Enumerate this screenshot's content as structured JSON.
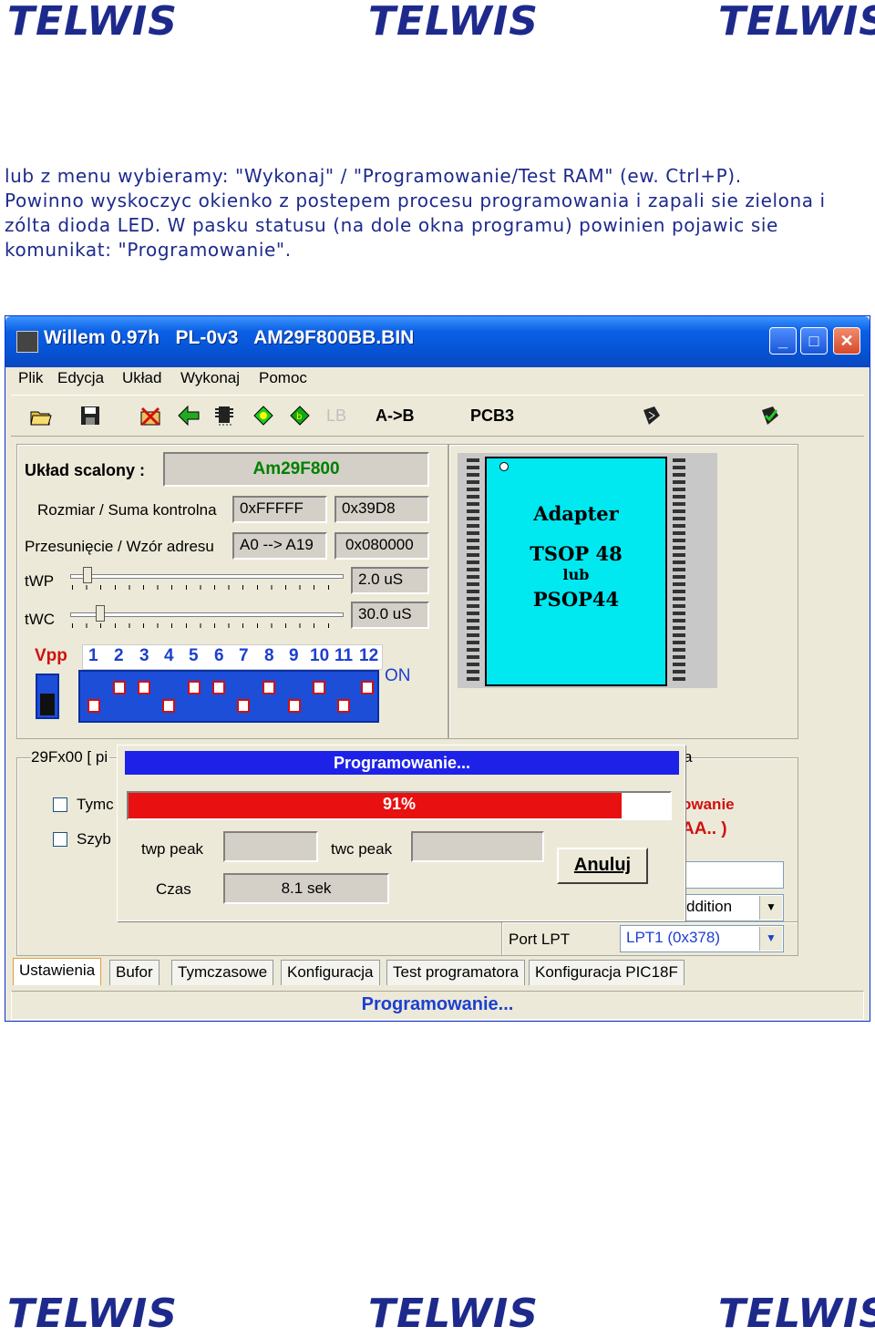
{
  "brand": {
    "text": "TELWIS"
  },
  "intro": {
    "line1": "lub z menu wybieramy: \"Wykonaj\" / \"Programowanie/Test RAM\" (ew. Ctrl+P).",
    "line2": "Powinno wyskoczyc okienko z postepem procesu programowania i zapali sie zielona i",
    "line3": "zólta dioda LED. W pasku statusu (na dole okna programu) powinien pojawic sie",
    "line4": "komunikat: \"Programowanie\"."
  },
  "window": {
    "title": "Willem 0.97h   PL-0v3   AM29F800BB.BIN",
    "menu": [
      "Plik",
      "Edycja",
      "Układ",
      "Wykonaj",
      "Pomoc"
    ],
    "toolbar": {
      "lb": "LB",
      "ab": "A->B",
      "pcb": "PCB3"
    },
    "icons": [
      "open-icon",
      "save-icon",
      "erase-icon",
      "read-icon",
      "chip-icon",
      "verify-icon",
      "blank-check-icon",
      "program-icon",
      "cancel-icon",
      "settings-icon"
    ],
    "chip_label": "Układ scalony :",
    "chip_value": "Am29F800",
    "size_label": "Rozmiar / Suma kontrolna",
    "size_value": "0xFFFFF",
    "checksum_value": "0x39D8",
    "offset_label": "Przesunięcie / Wzór adresu",
    "offset_value": "A0 --> A19",
    "pattern_value": "0x080000",
    "twp_label": "tWP",
    "twp_value": "2.0 uS",
    "twc_label": "tWC",
    "twc_value": "30.0 uS",
    "vpp_label": "Vpp",
    "dip_numbers": [
      "1",
      "2",
      "3",
      "4",
      "5",
      "6",
      "7",
      "8",
      "9",
      "10",
      "11",
      "12"
    ],
    "on_label": "ON",
    "adapter": {
      "line1": "Adapter",
      "line2": "TSOP 48",
      "line3": "lub",
      "line4": "PSOP44"
    },
    "group_label": "29Fx00 [ pi",
    "right_group_label": "a",
    "chk1_label": "Tymc",
    "chk2_label": "Szyb",
    "partial_red1": "owanie",
    "partial_red2": "AA.. )",
    "addition_combo": "ddition",
    "port_label": "Port LPT",
    "port_value": "LPT1 (0x378)",
    "tabs": [
      "Ustawienia",
      "Bufor",
      "Tymczasowe",
      "Konfiguracja",
      "Test programatora",
      "Konfiguracja PIC18F"
    ],
    "status": "Programowanie..."
  },
  "dialog": {
    "header": "Programowanie...",
    "progress_percent": 91,
    "progress_text": "91%",
    "twp_peak_label": "twp peak",
    "twc_peak_label": "twc peak",
    "time_label": "Czas",
    "time_value": "8.1 sek",
    "cancel_label": "Anuluj"
  },
  "colors": {
    "brand": "#1d2a8c",
    "progress": "#e81010",
    "chip": "#00e8f0",
    "titlebar": "#0653d4"
  }
}
